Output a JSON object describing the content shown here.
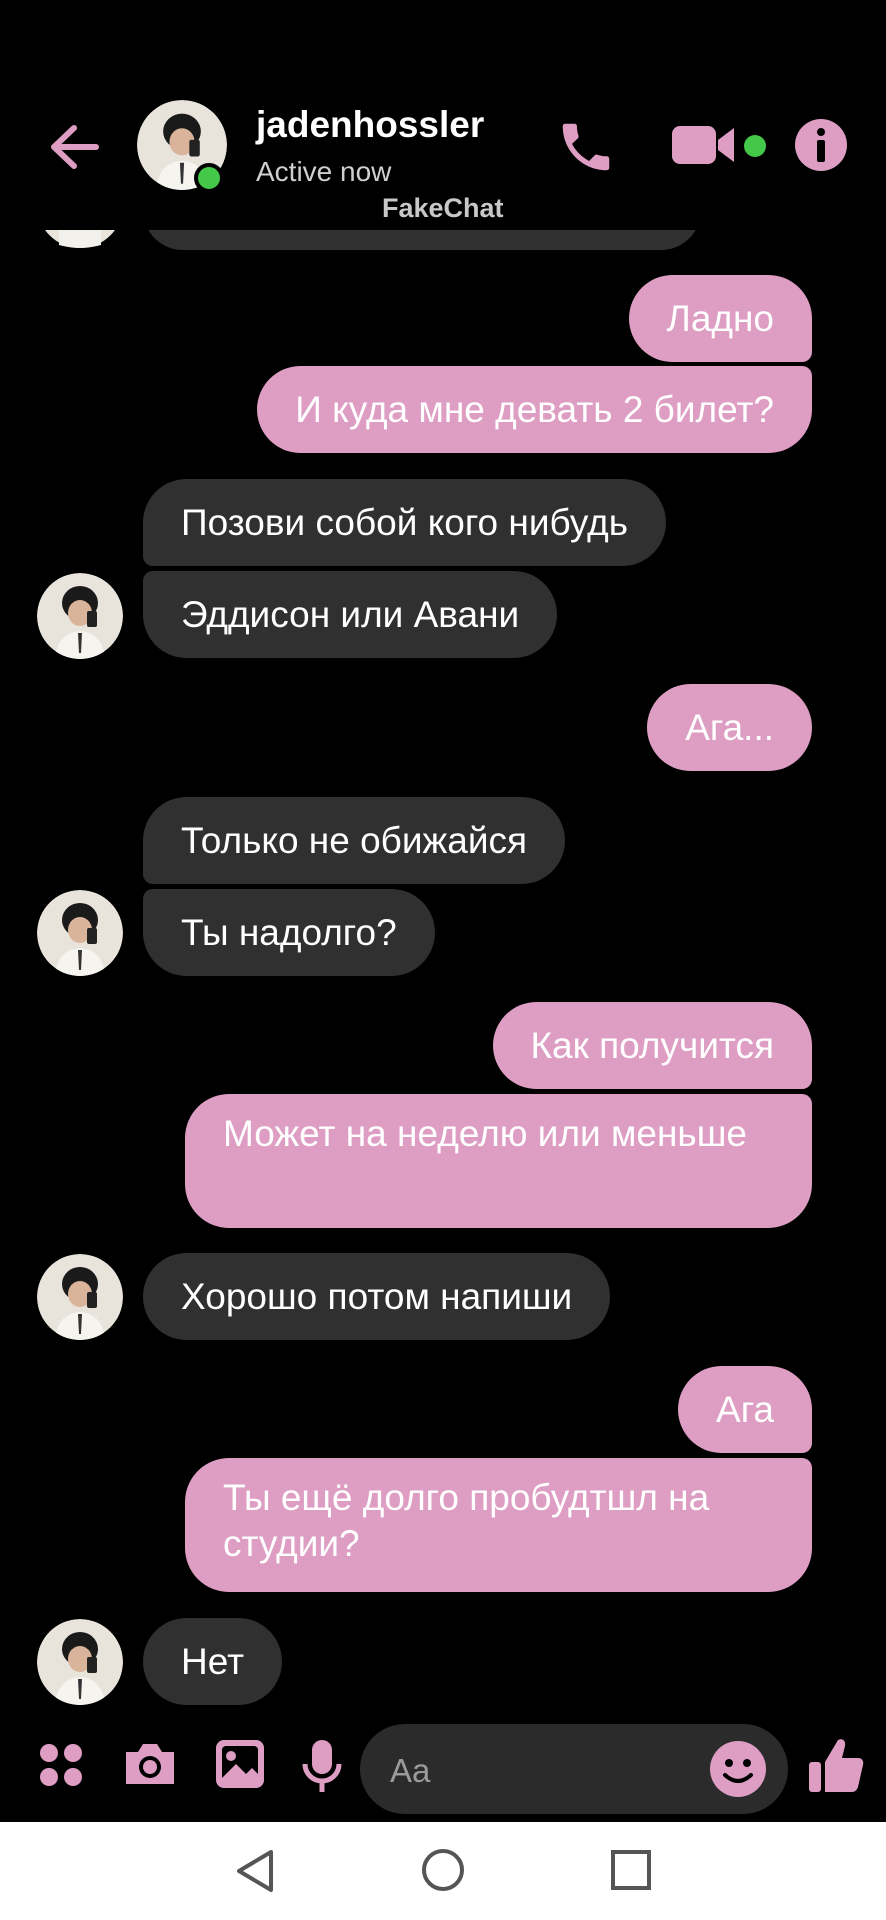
{
  "header": {
    "contact_name": "jadenhossler",
    "status": "Active now",
    "watermark": "FakeChat"
  },
  "messages": [
    {
      "id": "m1",
      "side": "out",
      "text": "Ладно"
    },
    {
      "id": "m2",
      "side": "out",
      "text": "И куда мне девать 2 билет?"
    },
    {
      "id": "m3",
      "side": "in",
      "text": "Позови собой кого нибудь"
    },
    {
      "id": "m4",
      "side": "in",
      "text": "Эддисон или Авани"
    },
    {
      "id": "m5",
      "side": "out",
      "text": "Ага..."
    },
    {
      "id": "m6",
      "side": "in",
      "text": "Только не обижайся"
    },
    {
      "id": "m7",
      "side": "in",
      "text": "Ты надолго?"
    },
    {
      "id": "m8",
      "side": "out",
      "text": "Как получится"
    },
    {
      "id": "m9",
      "side": "out",
      "text": "Может на неделю или меньше"
    },
    {
      "id": "m10",
      "side": "in",
      "text": "Хорошо потом напиши"
    },
    {
      "id": "m11",
      "side": "out",
      "text": "Ага"
    },
    {
      "id": "m12",
      "side": "out",
      "text": "Ты ещё долго пробудтшл на студии?"
    },
    {
      "id": "m13",
      "side": "in",
      "text": "Нет"
    }
  ],
  "composer": {
    "placeholder": "Aa",
    "icons": [
      "apps-icon",
      "camera-icon",
      "gallery-icon",
      "microphone-icon",
      "emoji-icon",
      "like-icon"
    ]
  },
  "colors": {
    "accent": "#de9ec4",
    "incoming_bubble": "#303030",
    "online": "#44c84a",
    "background": "#000000"
  },
  "navbar": {
    "icons": [
      "back-nav-icon",
      "home-nav-icon",
      "recents-nav-icon"
    ]
  }
}
